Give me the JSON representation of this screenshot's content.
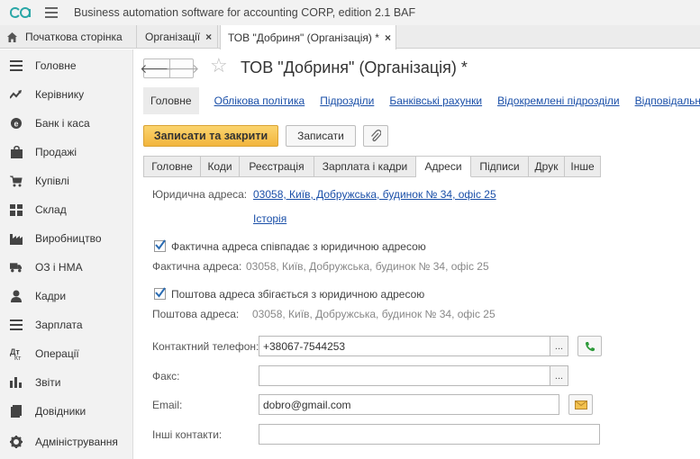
{
  "app": {
    "title": "Business automation software for accounting CORP, edition 2.1 BAF"
  },
  "tabs": {
    "home": "Початкова сторінка",
    "open": [
      {
        "label": "Організації",
        "close": "×"
      },
      {
        "label": "ТОВ \"Добриня\" (Організація) *",
        "close": "×"
      }
    ]
  },
  "sidebar": {
    "items": [
      {
        "label": "Головне",
        "icon": "menu-lines-icon"
      },
      {
        "label": "Керівнику",
        "icon": "trend-chart-icon"
      },
      {
        "label": "Банк і каса",
        "icon": "coin-icon"
      },
      {
        "label": "Продажі",
        "icon": "shopping-bag-icon"
      },
      {
        "label": "Купівлі",
        "icon": "cart-icon"
      },
      {
        "label": "Склад",
        "icon": "grid-warehouse-icon"
      },
      {
        "label": "Виробництво",
        "icon": "factory-icon"
      },
      {
        "label": "ОЗ і НМА",
        "icon": "truck-icon"
      },
      {
        "label": "Кадри",
        "icon": "person-icon"
      },
      {
        "label": "Зарплата",
        "icon": "payroll-icon"
      },
      {
        "label": "Операції",
        "icon": "operations-icon"
      },
      {
        "label": "Звіти",
        "icon": "bar-chart-icon"
      },
      {
        "label": "Довідники",
        "icon": "book-icon"
      },
      {
        "label": "Адміністрування",
        "icon": "gear-icon"
      }
    ]
  },
  "doc": {
    "title": "ТОВ \"Добриня\" (Організація) *",
    "back": "🡐",
    "forward": "🡒",
    "star": "☆"
  },
  "links": {
    "current": "Головне",
    "items": [
      "Облікова політика",
      "Підрозділи",
      "Банківські рахунки",
      "Відокремлені підрозділи",
      "Відповідальні"
    ]
  },
  "buttons": {
    "save_close": "Записати та закрити",
    "save": "Записати"
  },
  "form_tabs": [
    "Головне",
    "Коди",
    "Реєстрація",
    "Зарплата і кадри",
    "Адреси",
    "Підписи",
    "Друк",
    "Інше"
  ],
  "form_active_tab": "Адреси",
  "address": {
    "legal_label": "Юридична адреса:",
    "legal_value": "03058, Київ, Добружська, будинок № 34, офіс 25",
    "history": "Історія",
    "actual_check": "Фактична адреса співпадає з юридичною адресою",
    "actual_checked": true,
    "actual_label": "Фактична адреса:",
    "actual_value": "03058, Київ, Добружська, будинок № 34, офіс 25",
    "postal_check": "Поштова адреса збігається з юридичною адресою",
    "postal_checked": true,
    "postal_label": "Поштова адреса:",
    "postal_value": "03058, Київ, Добружська, будинок № 34, офіс 25"
  },
  "contacts": {
    "phone_label": "Контактний телефон:",
    "phone_value": "+38067-7544253",
    "fax_label": "Факс:",
    "fax_value": "",
    "email_label": "Email:",
    "email_value": "dobro@gmail.com",
    "other_label": "Інші контакти:",
    "other_value": "",
    "dots": "..."
  },
  "colors": {
    "accent_button": "#f2b53d",
    "link": "#1a4fa8",
    "phone_icon": "#2e9a3a"
  }
}
